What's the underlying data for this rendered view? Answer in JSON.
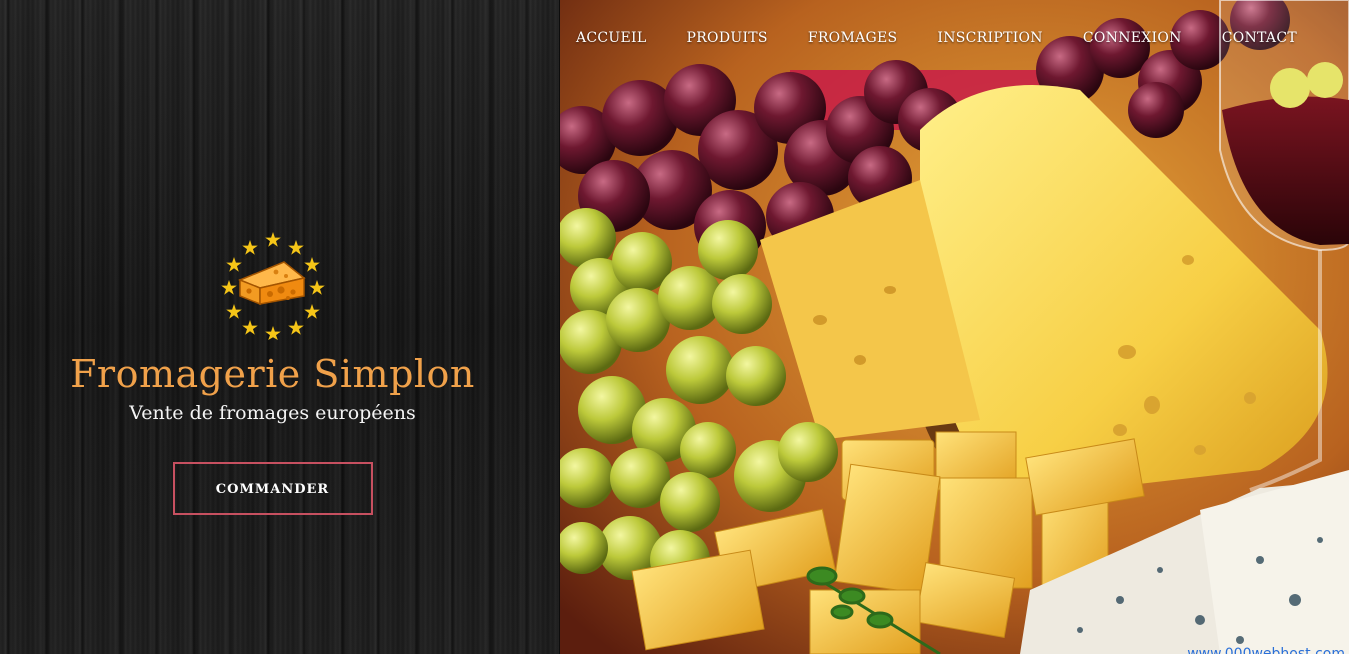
{
  "nav": {
    "items": [
      "ACCUEIL",
      "PRODUITS",
      "FROMAGES",
      "INSCRIPTION",
      "CONNEXION",
      "CONTACT"
    ]
  },
  "hero": {
    "title": "Fromagerie Simplon",
    "tagline": "Vente de fromages européens",
    "cta_label": "COMMANDER",
    "logo_icon": "cheese-stars-icon"
  },
  "watermark": "www.000webhost.com",
  "colors": {
    "title": "#f0a14a",
    "cta_border": "#c75060",
    "star": "#f5c518",
    "cheese": "#f29b22"
  }
}
